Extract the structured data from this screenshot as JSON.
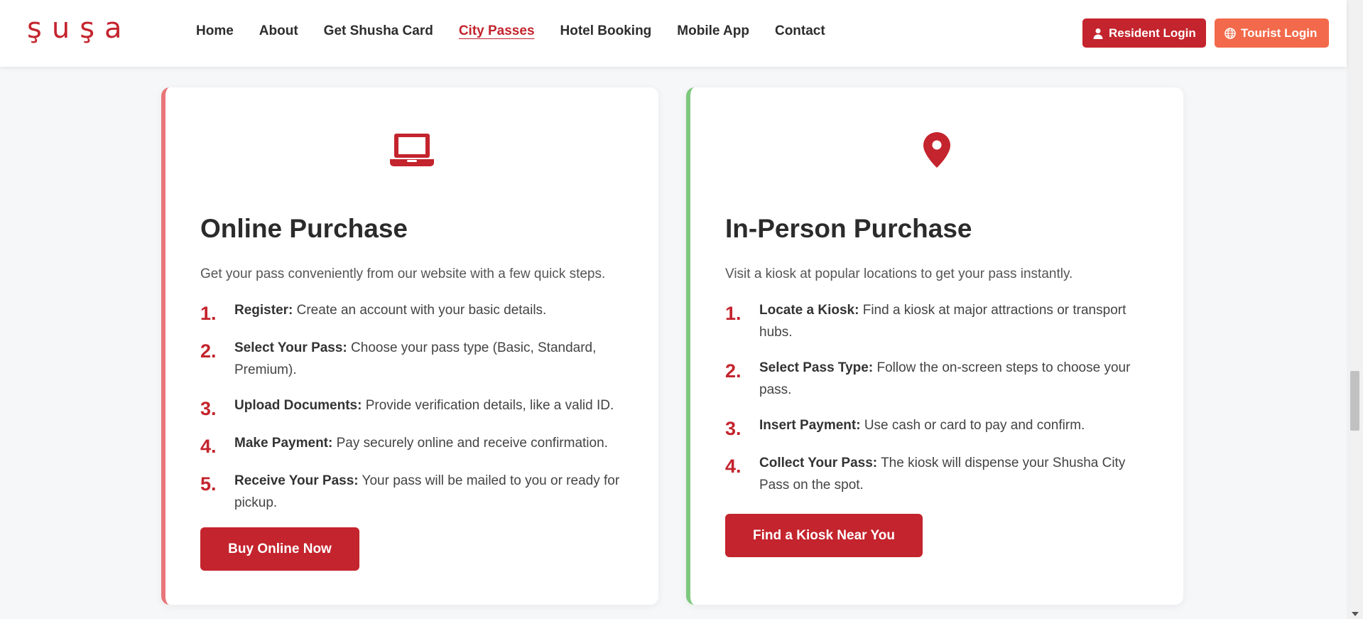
{
  "header": {
    "logo": "şuşa",
    "nav": [
      {
        "label": "Home",
        "active": false
      },
      {
        "label": "About",
        "active": false
      },
      {
        "label": "Get Shusha Card",
        "active": false
      },
      {
        "label": "City Passes",
        "active": true
      },
      {
        "label": "Hotel Booking",
        "active": false
      },
      {
        "label": "Mobile App",
        "active": false
      },
      {
        "label": "Contact",
        "active": false
      }
    ],
    "resident_login": "Resident Login",
    "tourist_login": "Tourist Login"
  },
  "colors": {
    "primary": "#c4242d",
    "tourist": "#f26a4b",
    "left_accent": "#e8767a",
    "right_accent": "#7ec87e"
  },
  "online": {
    "icon": "laptop-icon",
    "title": "Online Purchase",
    "desc": "Get your pass conveniently from our website with a few quick steps.",
    "steps": [
      {
        "num": "1.",
        "label": "Register:",
        "text": " Create an account with your basic details."
      },
      {
        "num": "2.",
        "label": "Select Your Pass:",
        "text": " Choose your pass type (Basic, Standard, Premium)."
      },
      {
        "num": "3.",
        "label": "Upload Documents:",
        "text": " Provide verification details, like a valid ID."
      },
      {
        "num": "4.",
        "label": "Make Payment:",
        "text": " Pay securely online and receive confirmation."
      },
      {
        "num": "5.",
        "label": "Receive Your Pass:",
        "text": " Your pass will be mailed to you or ready for pickup."
      }
    ],
    "button": "Buy Online Now"
  },
  "inperson": {
    "icon": "map-pin-icon",
    "title": "In-Person Purchase",
    "desc": "Visit a kiosk at popular locations to get your pass instantly.",
    "steps": [
      {
        "num": "1.",
        "label": "Locate a Kiosk:",
        "text": " Find a kiosk at major attractions or transport hubs."
      },
      {
        "num": "2.",
        "label": "Select Pass Type:",
        "text": " Follow the on-screen steps to choose your pass."
      },
      {
        "num": "3.",
        "label": "Insert Payment:",
        "text": " Use cash or card to pay and confirm."
      },
      {
        "num": "4.",
        "label": "Collect Your Pass:",
        "text": " The kiosk will dispense your Shusha City Pass on the spot."
      }
    ],
    "button": "Find a Kiosk Near You"
  }
}
